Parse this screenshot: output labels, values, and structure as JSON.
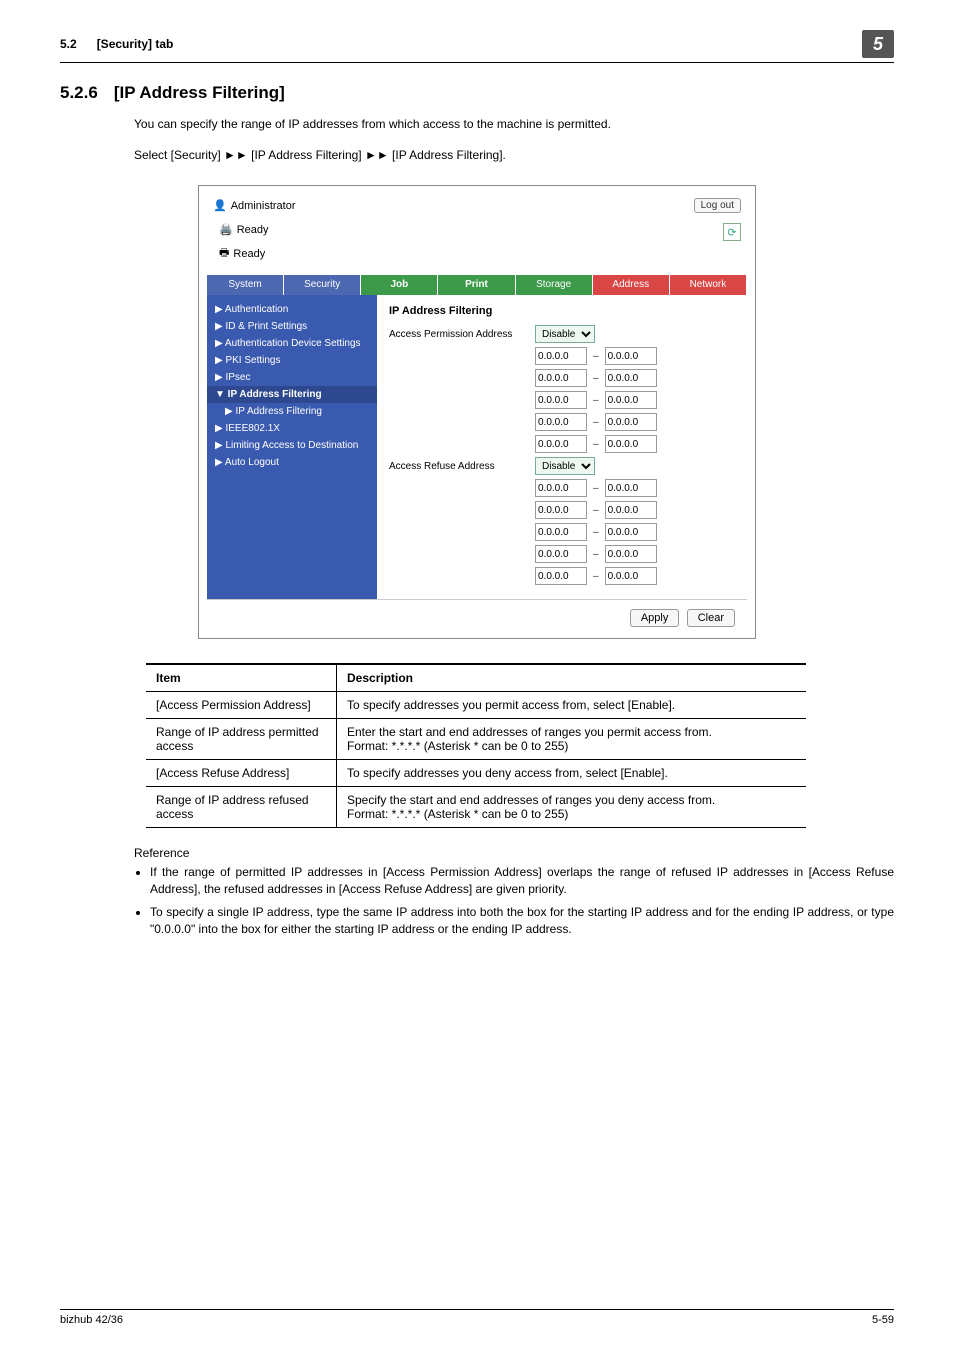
{
  "header": {
    "section_num": "5.2",
    "section_title": "[Security] tab",
    "badge": "5"
  },
  "heading": {
    "num": "5.2.6",
    "title": "[IP Address Filtering]"
  },
  "paragraphs": {
    "p1": "You can specify the range of IP addresses from which access to the machine is permitted.",
    "p2": "Select [Security] ►► [IP Address Filtering] ►► [IP Address Filtering]."
  },
  "screenshot": {
    "admin": "Administrator",
    "logout": "Log out",
    "readyPrinter": "Ready",
    "readyStatus": "Ready",
    "tabs": [
      "System",
      "Security",
      "Job",
      "Print",
      "Storage",
      "Address",
      "Network"
    ],
    "sidebar": [
      {
        "label": "▶ Authentication"
      },
      {
        "label": "▶ ID & Print Settings"
      },
      {
        "label": "▶ Authentication Device Settings"
      },
      {
        "label": "▶ PKI Settings"
      },
      {
        "label": "▶ IPsec"
      },
      {
        "label": "▼ IP Address Filtering",
        "sel": true
      },
      {
        "label": "▶ IP Address Filtering",
        "sub": true
      },
      {
        "label": "▶ IEEE802.1X"
      },
      {
        "label": "▶ Limiting Access to Destination"
      },
      {
        "label": "▶ Auto Logout"
      }
    ],
    "content": {
      "title": "IP Address Filtering",
      "permLabel": "Access Permission Address",
      "refuseLabel": "Access Refuse Address",
      "selectValue": "Disable",
      "ipA": "0.0.0.0",
      "ipB": "0.0.0.0",
      "apply": "Apply",
      "clear": "Clear"
    }
  },
  "table": {
    "headers": {
      "item": "Item",
      "desc": "Description"
    },
    "rows": [
      {
        "item": "[Access Permission Address]",
        "desc": "To specify addresses you permit access from, select [Enable]."
      },
      {
        "item": "Range of IP address permitted access",
        "desc": "Enter the start and end addresses of ranges you permit access from.\nFormat: *.*.*.* (Asterisk * can be 0 to 255)"
      },
      {
        "item": "[Access Refuse Address]",
        "desc": "To specify addresses you deny access from, select [Enable]."
      },
      {
        "item": "Range of IP address refused access",
        "desc": "Specify the start and end addresses of ranges you deny access from.\nFormat: *.*.*.* (Asterisk * can be 0 to 255)"
      }
    ]
  },
  "reference": {
    "label": "Reference",
    "b1": "If the range of permitted IP addresses in [Access Permission Address] overlaps the range of refused IP addresses in [Access Refuse Address], the refused addresses in [Access Refuse Address] are given priority.",
    "b2": "To specify a single IP address, type the same IP address into both the box for the starting IP address and for the ending IP address, or type \"0.0.0.0\" into the box for either the starting IP address or the ending IP address."
  },
  "footer": {
    "left": "bizhub 42/36",
    "right": "5-59"
  }
}
